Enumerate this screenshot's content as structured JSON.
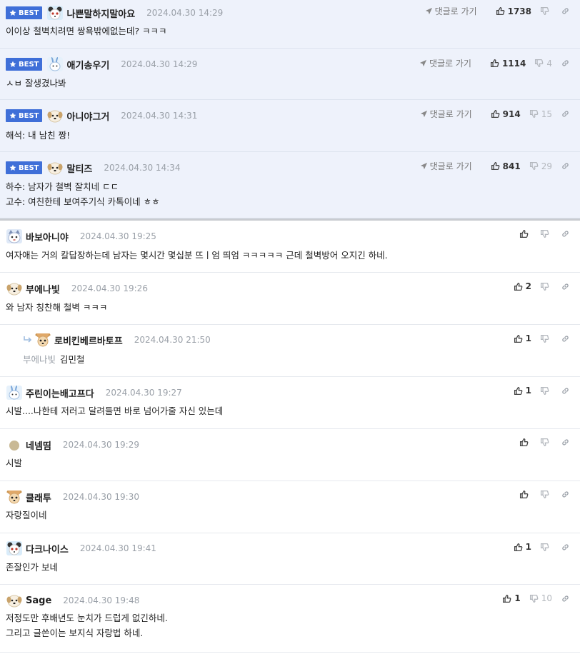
{
  "best_badge": "BEST",
  "goto_label": "댓글로 가기",
  "colors": {
    "accent": "#3f6fd8",
    "best_bg": "#eef2fb",
    "meta": "#9aa0a8"
  },
  "comments": [
    {
      "best": true,
      "avatar": "panda-avatar",
      "nick": "나쁜말하지말아요",
      "date": "2024.04.30 14:29",
      "lines": [
        "이이상 철벽치려면 쌍욕밖에없는데? ㅋㅋㅋ"
      ],
      "up": "1738",
      "down": "",
      "goto": true
    },
    {
      "best": true,
      "avatar": "rabbit-avatar",
      "nick": "애기송우기",
      "date": "2024.04.30 14:29",
      "lines": [
        "ㅅㅂ 잘생겼나봐"
      ],
      "up": "1114",
      "down": "4",
      "goto": true
    },
    {
      "best": true,
      "avatar": "puppy-avatar",
      "nick": "아니야그거",
      "date": "2024.04.30 14:31",
      "lines": [
        "해석: 내 남친 짱!"
      ],
      "up": "914",
      "down": "15",
      "goto": true
    },
    {
      "best": true,
      "avatar": "puppy-avatar",
      "nick": "말티즈",
      "date": "2024.04.30 14:34",
      "lines": [
        "하수: 남자가 철벽 잘치네 ㄷㄷ",
        "고수: 여친한테 보여주기식 카톡이네 ㅎㅎ"
      ],
      "up": "841",
      "down": "29",
      "goto": true
    },
    {
      "best": false,
      "avatar": "cat-avatar",
      "nick": "바보아니야",
      "date": "2024.04.30 19:25",
      "lines": [
        "여자애는 거의 칼답장하는데 남자는 몇시간 몇십분 뜨ㅣ엄 띄엄 ㅋㅋㅋㅋㅋ 근데 철벽방어 오지긴 하네."
      ],
      "up": "",
      "down": "",
      "goto": false
    },
    {
      "best": false,
      "avatar": "puppy-avatar",
      "nick": "부에나빛",
      "date": "2024.04.30 19:26",
      "lines": [
        "와 남자 칭찬해 철벽 ㅋㅋㅋ"
      ],
      "up": "2",
      "down": "",
      "goto": false
    },
    {
      "best": false,
      "reply": true,
      "reply_to": "부에나빛",
      "avatar": "chihuahua-avatar",
      "nick": "로비킨베르바토프",
      "date": "2024.04.30 21:50",
      "lines": [
        "김민철"
      ],
      "up": "1",
      "down": "",
      "goto": false
    },
    {
      "best": false,
      "avatar": "rabbit-avatar",
      "nick": "주린이는배고프다",
      "date": "2024.04.30 19:27",
      "lines": [
        "시발....나한테 저러고 달려들면 바로 넘어가줄 자신 있는데"
      ],
      "up": "1",
      "down": "",
      "goto": false
    },
    {
      "best": false,
      "avatar": "dot-avatar",
      "nick": "네넴띰",
      "date": "2024.04.30 19:29",
      "lines": [
        "시발"
      ],
      "up": "",
      "down": "",
      "goto": false
    },
    {
      "best": false,
      "avatar": "chihuahua-avatar",
      "nick": "클래투",
      "date": "2024.04.30 19:30",
      "lines": [
        "자랑질이네"
      ],
      "up": "",
      "down": "",
      "goto": false
    },
    {
      "best": false,
      "avatar": "panda-avatar",
      "nick": "다크나이스",
      "date": "2024.04.30 19:41",
      "lines": [
        "존잘인가 보네"
      ],
      "up": "1",
      "down": "",
      "goto": false
    },
    {
      "best": false,
      "avatar": "puppy-avatar",
      "nick": "Sage",
      "date": "2024.04.30 19:48",
      "lines": [
        "저정도만 후배년도 눈치가 드럽게 없긴하네.",
        "그리고 글쓴이는 보지식 자랑법 하네."
      ],
      "up": "1",
      "down": "10",
      "goto": false
    }
  ]
}
